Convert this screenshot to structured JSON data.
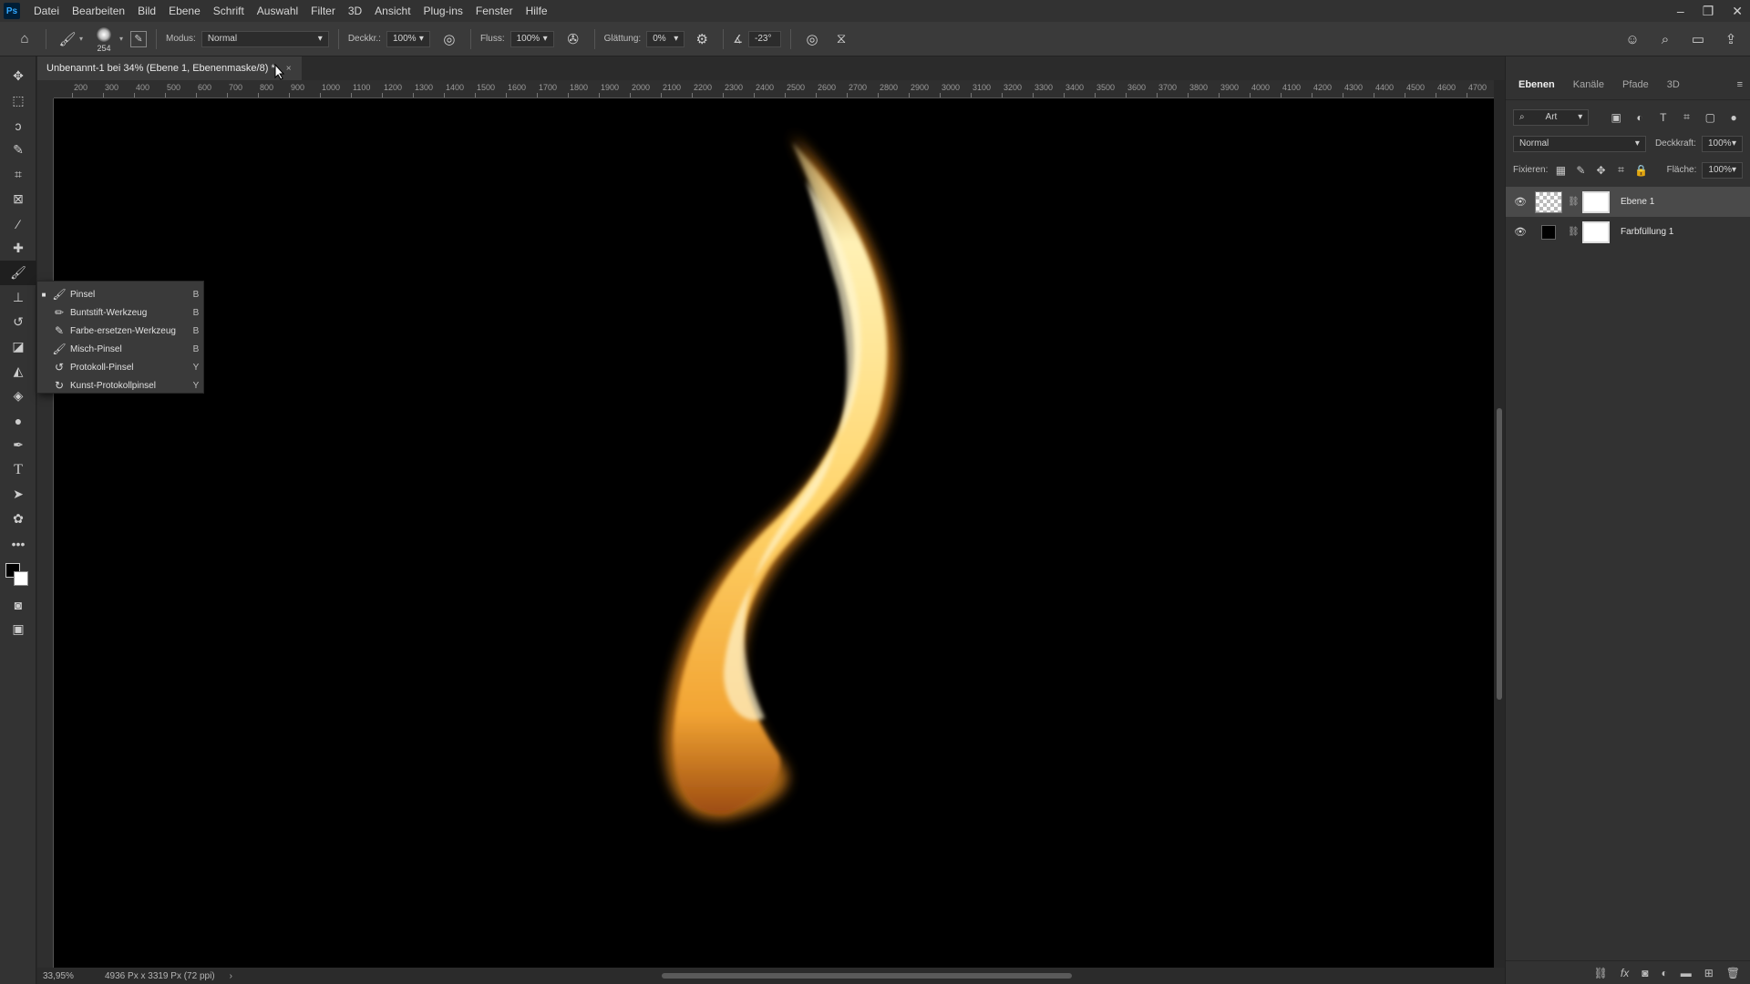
{
  "menu": {
    "logo": "Ps",
    "items": [
      "Datei",
      "Bearbeiten",
      "Bild",
      "Ebene",
      "Schrift",
      "Auswahl",
      "Filter",
      "3D",
      "Ansicht",
      "Plug-ins",
      "Fenster",
      "Hilfe"
    ],
    "window_controls": [
      "–",
      "❐",
      "✕"
    ]
  },
  "options": {
    "brush_size": "254",
    "mode_label": "Modus:",
    "mode_value": "Normal",
    "opacity_label": "Deckkr.:",
    "opacity_value": "100%",
    "flow_label": "Fluss:",
    "flow_value": "100%",
    "smoothing_label": "Glättung:",
    "smoothing_value": "0%",
    "angle_value": "-23°"
  },
  "document": {
    "tab_title": "Unbenannt-1 bei 34% (Ebene 1, Ebenenmaske/8) *",
    "close": "×"
  },
  "ruler": {
    "labels": [
      "200",
      "300",
      "400",
      "500",
      "600",
      "700",
      "800",
      "900",
      "1000",
      "1100",
      "1200",
      "1300",
      "1400",
      "1500",
      "1600",
      "1700",
      "1800",
      "1900",
      "2000",
      "2100",
      "2200",
      "2300",
      "2400",
      "2500",
      "2600",
      "2700",
      "2800",
      "2900",
      "3000",
      "3100",
      "3200",
      "3300",
      "3400",
      "3500",
      "3600",
      "3700",
      "3800",
      "3900",
      "4000",
      "4100",
      "4200",
      "4300",
      "4400",
      "4500",
      "4600",
      "4700"
    ]
  },
  "status": {
    "zoom": "33,95%",
    "doc_size": "4936 Px x 3319 Px (72 ppi)"
  },
  "flyout": {
    "items": [
      {
        "label": "Pinsel",
        "key": "B",
        "selected": true
      },
      {
        "label": "Buntstift-Werkzeug",
        "key": "B",
        "selected": false
      },
      {
        "label": "Farbe-ersetzen-Werkzeug",
        "key": "B",
        "selected": false
      },
      {
        "label": "Misch-Pinsel",
        "key": "B",
        "selected": false
      },
      {
        "label": "Protokoll-Pinsel",
        "key": "Y",
        "selected": false
      },
      {
        "label": "Kunst-Protokollpinsel",
        "key": "Y",
        "selected": false
      }
    ]
  },
  "panel": {
    "tabs": [
      "Ebenen",
      "Kanäle",
      "Pfade",
      "3D"
    ],
    "filter_label": "Art",
    "blend_mode": "Normal",
    "opacity_label": "Deckkraft:",
    "opacity_value": "100%",
    "lock_label": "Fixieren:",
    "fill_label": "Fläche:",
    "fill_value": "100%",
    "layers": [
      {
        "name": "Ebene 1",
        "selected": true
      },
      {
        "name": "Farbfüllung 1",
        "selected": false
      }
    ],
    "bottom_fx": "fx"
  }
}
